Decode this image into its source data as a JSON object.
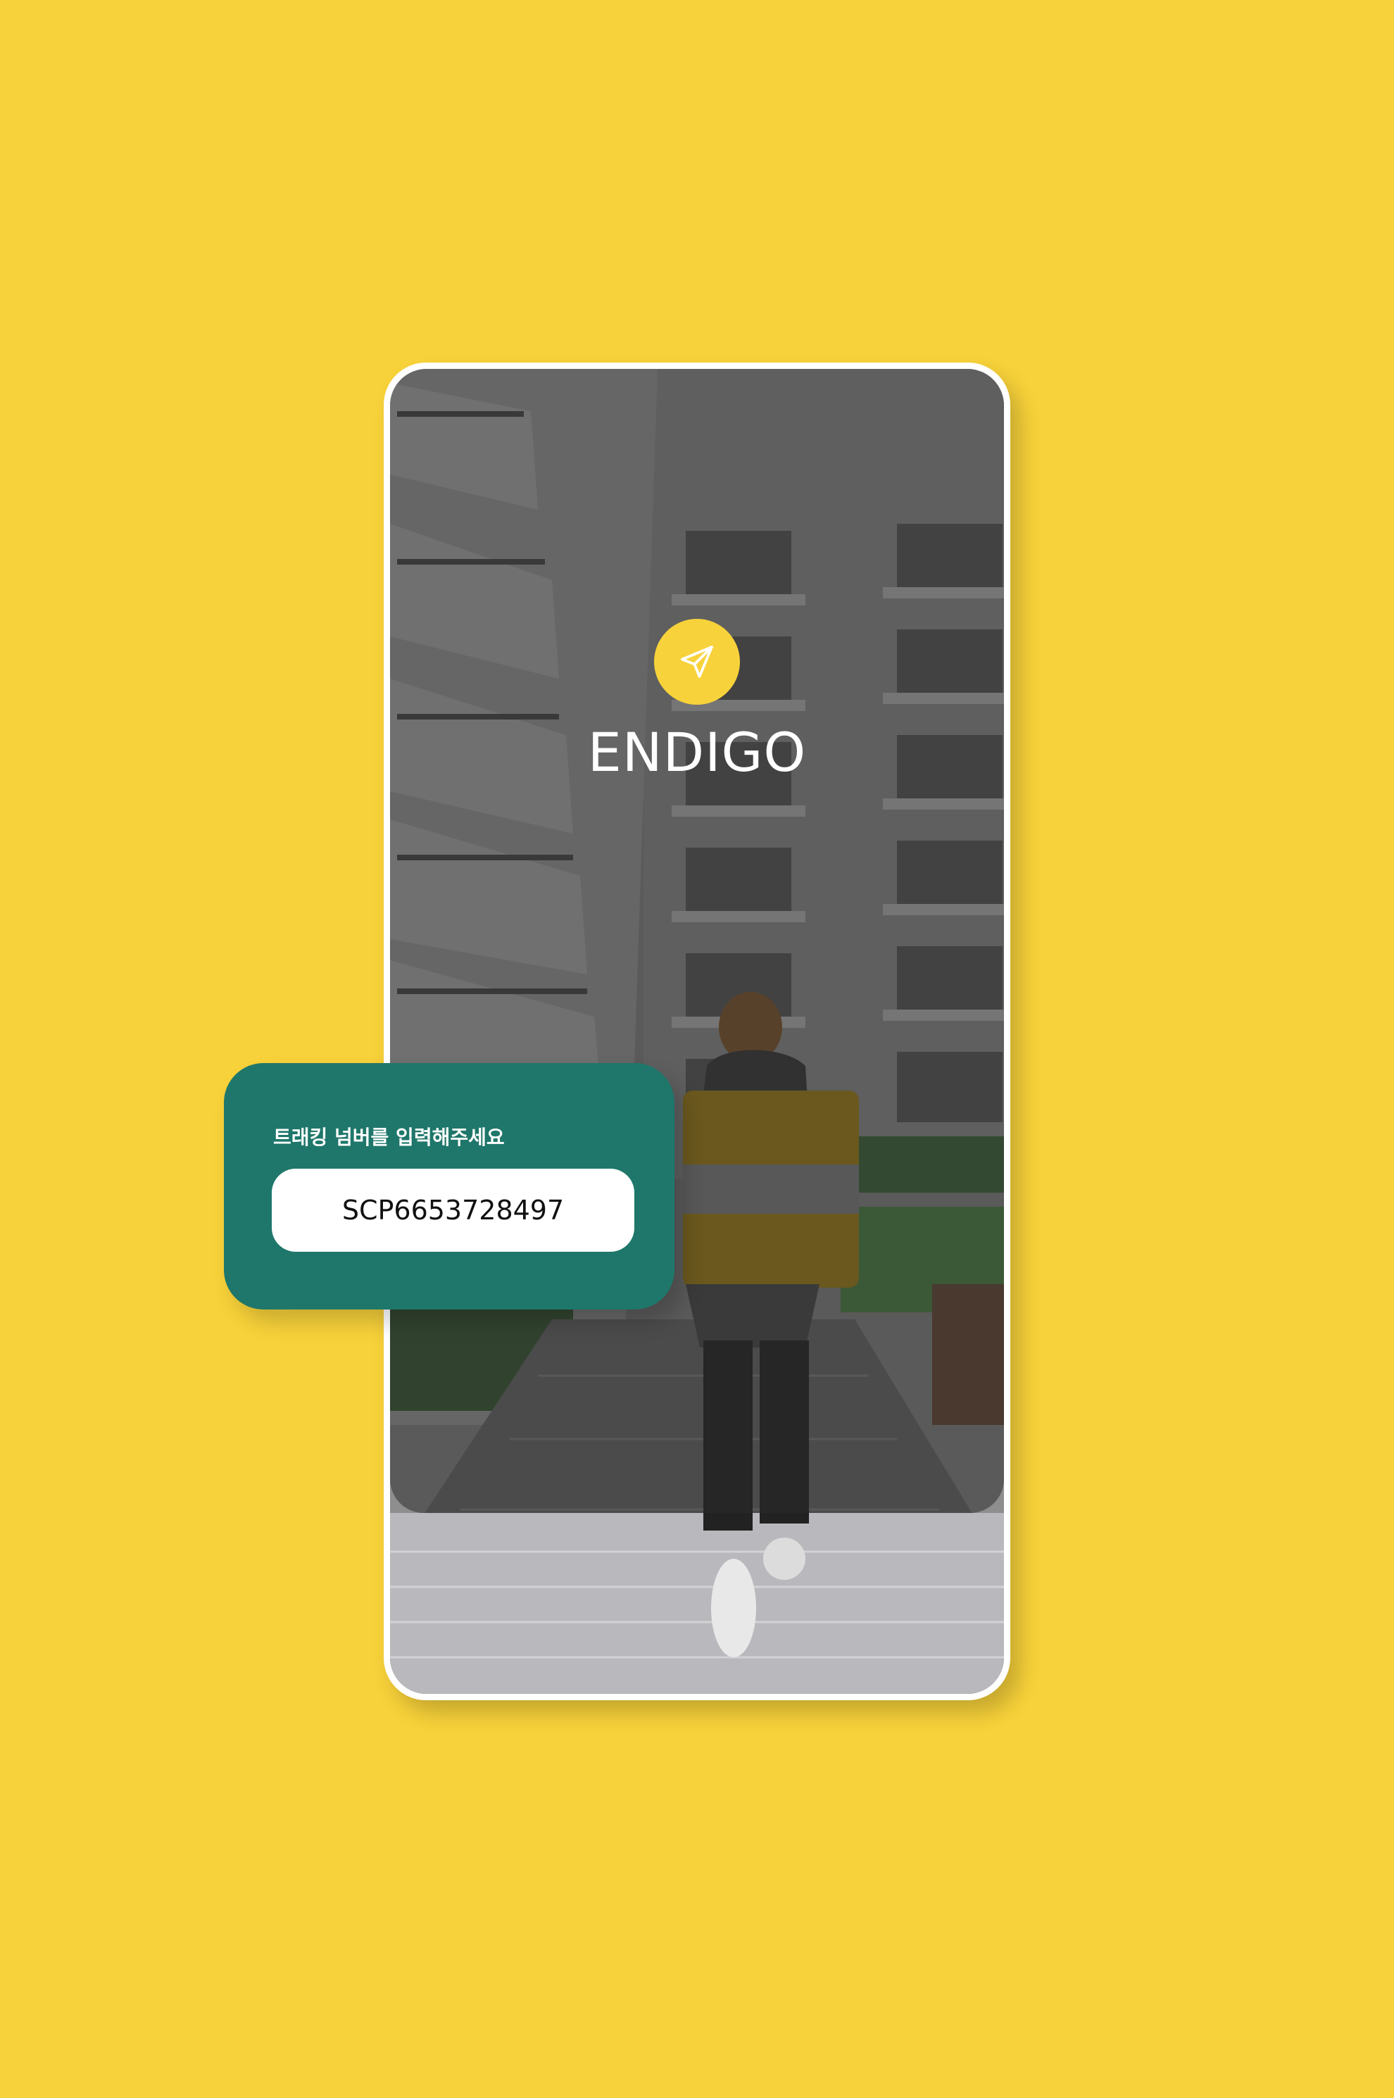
{
  "brand": {
    "name": "ENDIGO",
    "logo_icon": "paper-plane-icon"
  },
  "tracking": {
    "label": "트래킹 넘버를 입력해주세요",
    "value": "SCP6653728497"
  },
  "colors": {
    "background": "#F8D23A",
    "accent": "#F8D23A",
    "card": "#1E776A",
    "input": "#FFFFFF"
  }
}
